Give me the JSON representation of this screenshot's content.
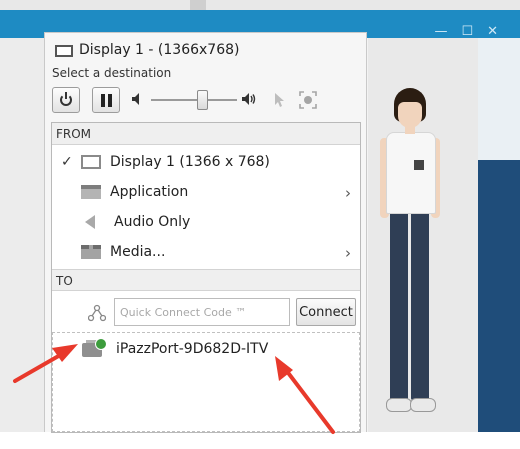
{
  "popup": {
    "title": "Display 1 - (1366x768)",
    "subtitle": "Select a destination"
  },
  "toolbar": {
    "power_icon": "power-icon",
    "pause_icon": "pause-icon",
    "volume_level": 0.6,
    "cursor_icon": "cursor-arrow-icon",
    "capture_icon": "screen-capture-icon"
  },
  "from": {
    "header": "FROM",
    "items": [
      {
        "label": "Display 1 (1366 x 768)",
        "checked": true,
        "icon": "display-icon",
        "has_submenu": false
      },
      {
        "label": "Application",
        "checked": false,
        "icon": "application-icon",
        "has_submenu": true
      },
      {
        "label": "Audio Only",
        "checked": false,
        "icon": "speaker-icon",
        "has_submenu": false
      },
      {
        "label": "Media...",
        "checked": false,
        "icon": "media-icon",
        "has_submenu": true
      }
    ]
  },
  "to": {
    "header": "TO",
    "quick_connect_placeholder": "Quick Connect Code ™",
    "connect_label": "Connect",
    "devices": [
      {
        "name": "iPazzPort-9D682D-ITV",
        "status": "available"
      }
    ]
  },
  "marks": {
    "checkmark": "✓",
    "chevron": "›"
  },
  "colors": {
    "accent_blue": "#1e8bc3",
    "arrow_red": "#e8392b",
    "status_green": "#3c9c3c"
  }
}
